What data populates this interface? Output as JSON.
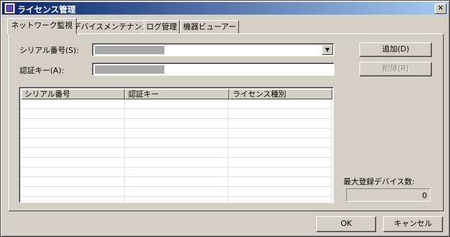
{
  "window": {
    "title": "ライセンス管理",
    "close_symbol": "✕"
  },
  "tabs": [
    {
      "label": "ネットワーク監視",
      "active": true
    },
    {
      "label": "デバイスメンテナンス",
      "active": false
    },
    {
      "label": "ログ管理",
      "active": false
    },
    {
      "label": "機器ビューアー",
      "active": false
    }
  ],
  "form": {
    "serial_label": "シリアル番号(S):",
    "serial_value": "",
    "auth_label": "認証キー(A):",
    "auth_value": ""
  },
  "buttons": {
    "add": "追加(D)",
    "delete": "削除(R)",
    "ok": "OK",
    "cancel": "キャンセル"
  },
  "table": {
    "headers": [
      "シリアル番号",
      "認証キー",
      "ライセンス種別"
    ],
    "rows": [
      [],
      [],
      [],
      [],
      [],
      [],
      [],
      [],
      [],
      [],
      []
    ]
  },
  "max_devices": {
    "label": "最大登録デバイス数:",
    "value": "0"
  }
}
